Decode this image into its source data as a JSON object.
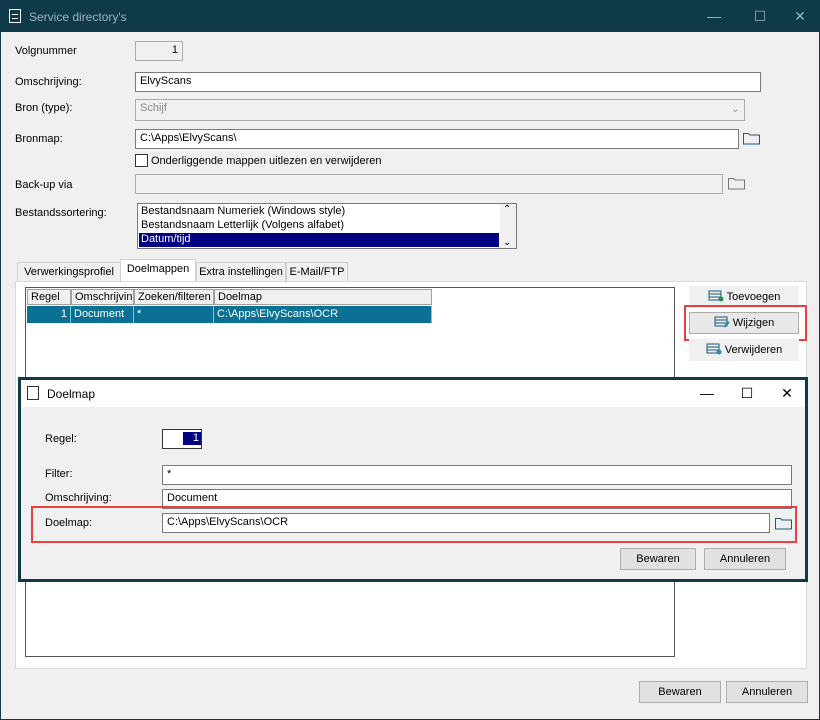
{
  "window": {
    "title": "Service directory's"
  },
  "form": {
    "volgnummer_label": "Volgnummer",
    "volgnummer_value": "1",
    "omschrijving_label": "Omschrijving:",
    "omschrijving_value": "ElvyScans",
    "bron_label": "Bron (type):",
    "bron_value": "Schijf",
    "bronmap_label": "Bronmap:",
    "bronmap_value": "C:\\Apps\\ElvyScans\\",
    "subfolders_label": "Onderliggende mappen uitlezen en verwijderen",
    "backup_label": "Back-up via",
    "backup_value": "",
    "sort_label": "Bestandssortering:",
    "sort_options": [
      "Bestandsnaam Numeriek (Windows style)",
      "Bestandsnaam Letterlijk (Volgens alfabet)",
      "Datum/tijd"
    ],
    "sort_selected_index": 2
  },
  "tabs": [
    {
      "label": "Verwerkingsprofiel"
    },
    {
      "label": "Doelmappen"
    },
    {
      "label": "Extra instellingen"
    },
    {
      "label": "E-Mail/FTP"
    }
  ],
  "grid": {
    "headers": [
      "Regel",
      "Omschrijvin",
      "Zoeken/filteren",
      "Doelmap"
    ],
    "rows": [
      [
        "1",
        "Document",
        "*",
        "C:\\Apps\\ElvyScans\\OCR"
      ]
    ]
  },
  "side_buttons": {
    "add": "Toevoegen",
    "edit": "Wijzigen",
    "delete": "Verwijderen"
  },
  "dialog": {
    "title": "Doelmap",
    "regel_label": "Regel:",
    "regel_value": "1",
    "filter_label": "Filter:",
    "filter_value": "*",
    "omschrijving_label": "Omschrijving:",
    "omschrijving_value": "Document",
    "doelmap_label": "Doelmap:",
    "doelmap_value": "C:\\Apps\\ElvyScans\\OCR",
    "save": "Bewaren",
    "cancel": "Annuleren"
  },
  "footer": {
    "save": "Bewaren",
    "cancel": "Annuleren"
  },
  "colors": {
    "titlebar": "#0f3a4a",
    "selection": "#000080",
    "grid_selection": "#0a7194",
    "highlight": "#e84040"
  }
}
